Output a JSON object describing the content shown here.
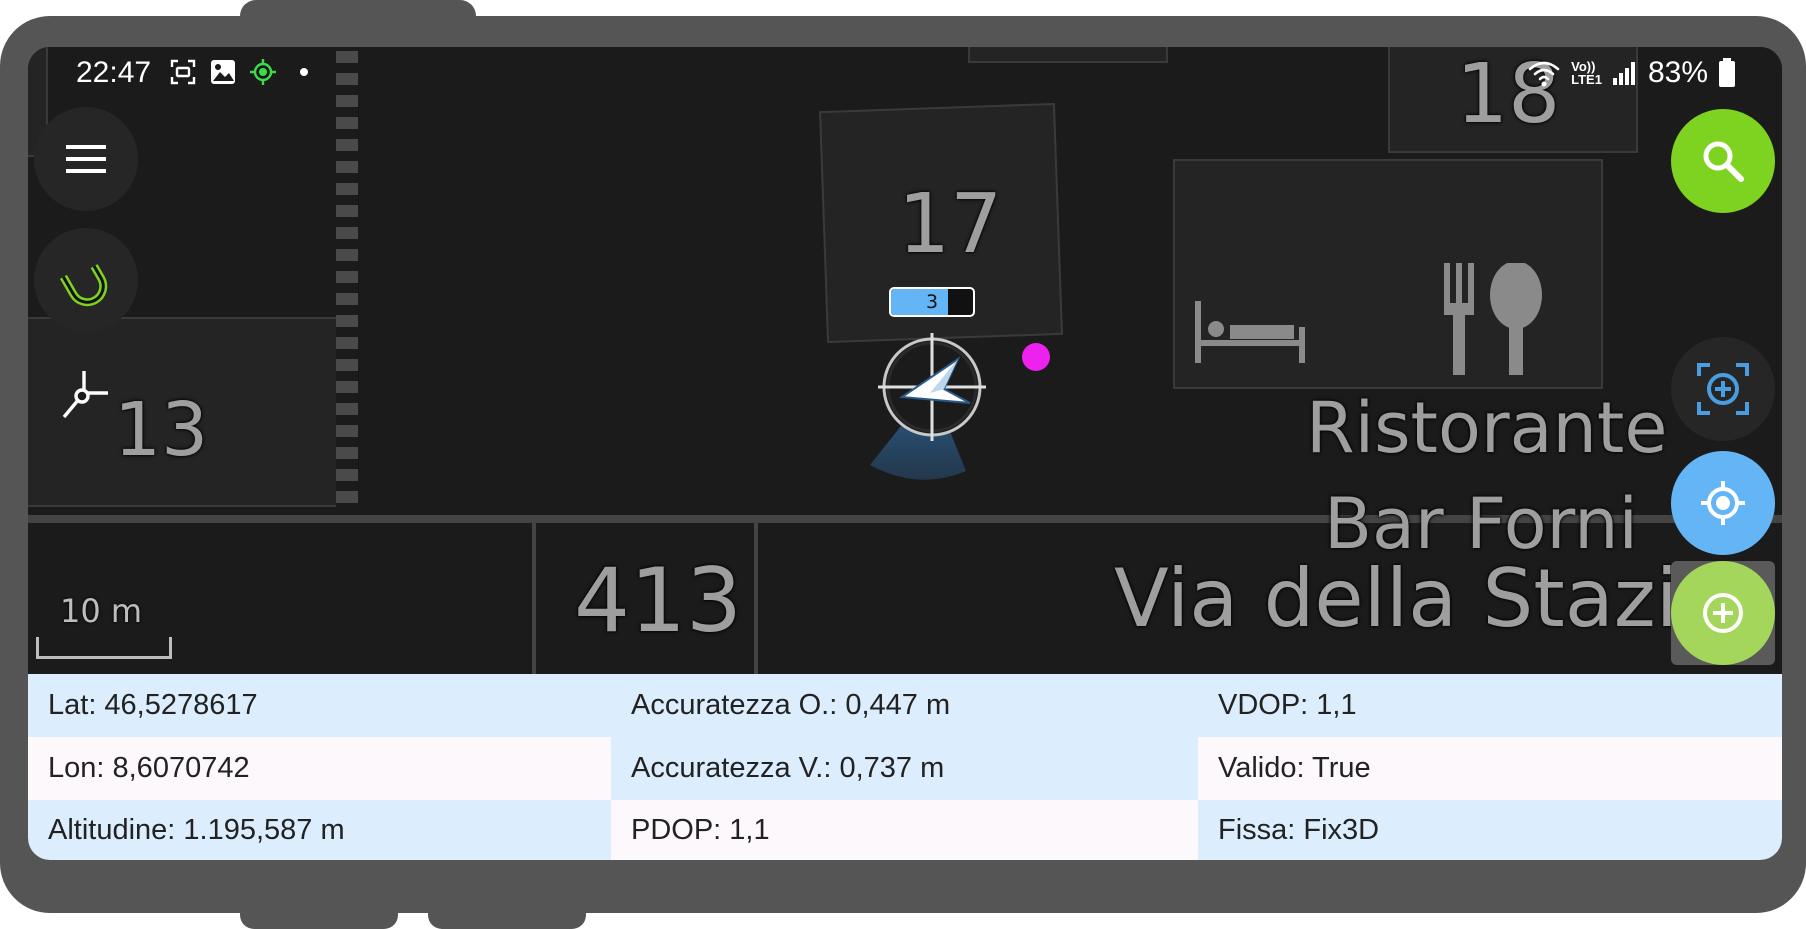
{
  "status_bar": {
    "time": "22:47",
    "battery": "83%",
    "lte_label": "LTE1",
    "volte_label": "Vo))",
    "icons": [
      "screen-record-icon",
      "gallery-icon",
      "gps-active-icon",
      "notification-dot-icon",
      "wifi-icon",
      "volte-icon",
      "signal-icon",
      "battery-icon"
    ]
  },
  "map": {
    "house_numbers": [
      "17",
      "18",
      "13",
      "413"
    ],
    "poi_name_line1": "Ristorante",
    "poi_name_line2": "Bar Forni",
    "street_name": "Via della Stazi",
    "scale_label": "10 m",
    "satellite_count": "3",
    "gps_signal_level": 0.7,
    "accent_color_pink": "#ee22ee"
  },
  "controls": {
    "left": [
      "menu-icon",
      "magnet-snap-icon",
      "digitize-vertex-icon"
    ],
    "right": [
      "search-icon",
      "center-target-icon",
      "my-location-icon",
      "add-point-icon"
    ],
    "colors": {
      "search": "#7ed321",
      "location": "#64b5f6",
      "add": "#a5d65c",
      "magnet": "#7ed321"
    }
  },
  "info_table": {
    "rows": [
      [
        "Lat: 46,5278617",
        "Accuratezza O.: 0,447 m",
        "VDOP: 1,1"
      ],
      [
        "Lon: 8,6070742",
        "Accuratezza V.: 0,737 m",
        "Valido: True"
      ],
      [
        "Altitudine: 1.195,587 m",
        "PDOP: 1,1",
        "Fissa: Fix3D"
      ]
    ]
  }
}
